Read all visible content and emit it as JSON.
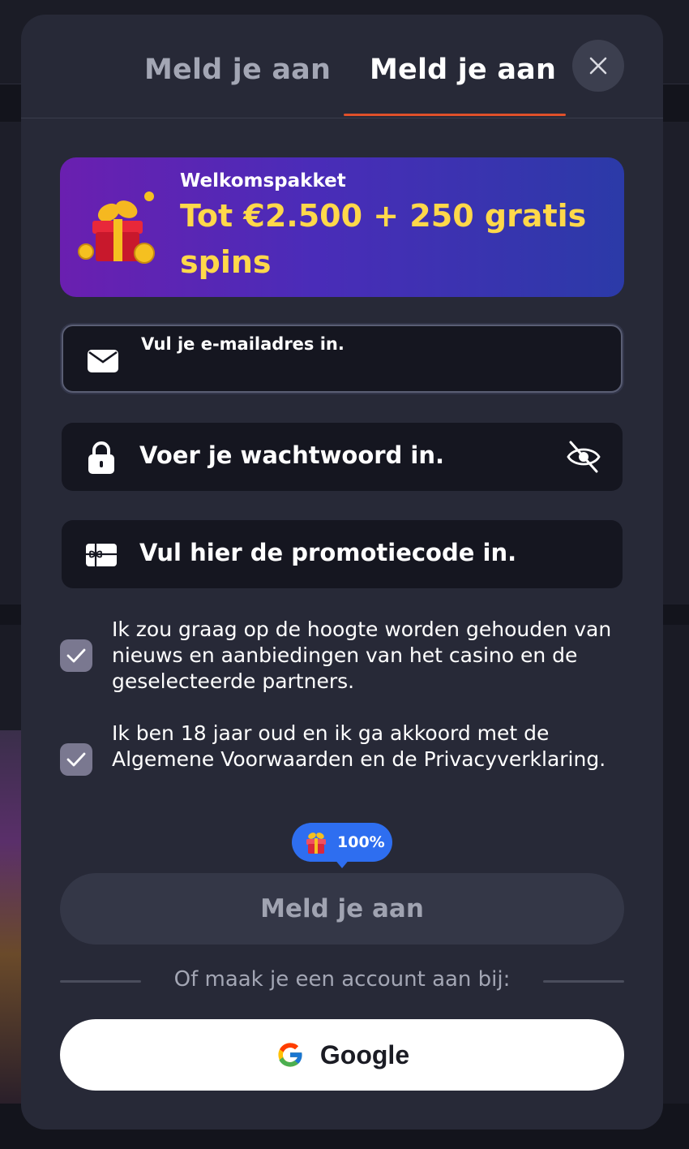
{
  "tabs": {
    "login": "Meld je aan",
    "register": "Meld je aan"
  },
  "promo": {
    "subtitle": "Welkomspakket",
    "title": "Tot €2.500 + 250 gratis spins"
  },
  "email_field": {
    "label": "Vul je e-mailadres in.",
    "value": ""
  },
  "password_field": {
    "placeholder": "Voer je wachtwoord in."
  },
  "promo_field": {
    "placeholder": "Vul hier de promotiecode in."
  },
  "checkboxes": [
    {
      "label": "Ik zou graag op de hoogte worden gehouden van nieuws en aanbiedingen van het casino en de geselecteerde partners.",
      "checked": true
    },
    {
      "label": "Ik ben 18 jaar oud en ik ga akkoord met de Algemene Voorwaarden en de Privacyverklaring.",
      "checked": true
    }
  ],
  "bonus_badge": "100%",
  "submit_label": "Meld je aan",
  "divider_text": "Of maak je een account aan bij:",
  "google_label": "Google",
  "colors": {
    "accent": "#e0502a",
    "promo_title": "#ffd84a",
    "badge": "#2e6ef0",
    "modal_bg": "#272937"
  }
}
